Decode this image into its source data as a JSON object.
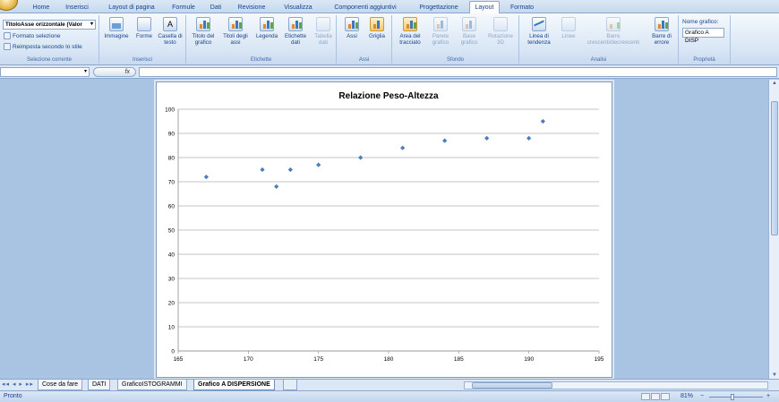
{
  "ribbon_tabs": [
    "Home",
    "Inserisci",
    "Layout di pagina",
    "Formule",
    "Dati",
    "Revisione",
    "Visualizza",
    "Componenti aggiuntivi",
    "Progettazione",
    "Layout",
    "Formato"
  ],
  "active_tab": "Layout",
  "selection_group": {
    "selected_element": "TitoloAsse orizzontale (Valor",
    "format_selection": "Formato selezione",
    "reset_style": "Reimposta secondo lo stile",
    "label": "Selezione corrente"
  },
  "insert_group": {
    "label": "Inserisci",
    "buttons": [
      "Immagine",
      "Forme",
      "Casella di testo"
    ]
  },
  "labels_group": {
    "label": "Etichette",
    "buttons": [
      "Titolo del grafico",
      "Titoli degli assi",
      "Legenda",
      "Etichette dati",
      "Tabella dati"
    ]
  },
  "axes_group": {
    "label": "Assi",
    "buttons": [
      "Assi",
      "Griglia"
    ]
  },
  "background_group": {
    "label": "Sfondo",
    "buttons": [
      "Area del tracciato",
      "Parete grafico",
      "Base grafico",
      "Rotazione 3D"
    ]
  },
  "analysis_group": {
    "label": "Analisi",
    "buttons": [
      "Linea di tendenza",
      "Linee",
      "Barre crescenti/decrescenti",
      "Barre di errore"
    ]
  },
  "properties_group": {
    "label": "Proprietà",
    "name_label": "Nome grafico:",
    "name_value": "Grafico A DISP"
  },
  "formula_bar": {
    "fx_label": "fx",
    "value": ""
  },
  "sheet_tabs": [
    "Cose da fare",
    "DATI",
    "GraficoISTOGRAMMI",
    "Grafico A DISPERSIONE"
  ],
  "active_sheet": "Grafico A DISPERSIONE",
  "status": {
    "ready": "Pronto",
    "zoom": "81%"
  },
  "chart_data": {
    "type": "scatter",
    "title": "Relazione Peso-Altezza",
    "xlabel": "",
    "ylabel": "",
    "xlim": [
      165,
      195
    ],
    "ylim": [
      0,
      100
    ],
    "x_ticks": [
      165,
      170,
      175,
      180,
      185,
      190,
      195
    ],
    "y_ticks": [
      0,
      10,
      20,
      30,
      40,
      50,
      60,
      70,
      80,
      90,
      100
    ],
    "grid": true,
    "marker_color": "#4a7ebb",
    "points": [
      {
        "x": 167,
        "y": 72
      },
      {
        "x": 171,
        "y": 75
      },
      {
        "x": 172,
        "y": 68
      },
      {
        "x": 173,
        "y": 75
      },
      {
        "x": 175,
        "y": 77
      },
      {
        "x": 178,
        "y": 80
      },
      {
        "x": 181,
        "y": 84
      },
      {
        "x": 184,
        "y": 87
      },
      {
        "x": 187,
        "y": 88
      },
      {
        "x": 190,
        "y": 88
      },
      {
        "x": 191,
        "y": 95
      }
    ]
  }
}
